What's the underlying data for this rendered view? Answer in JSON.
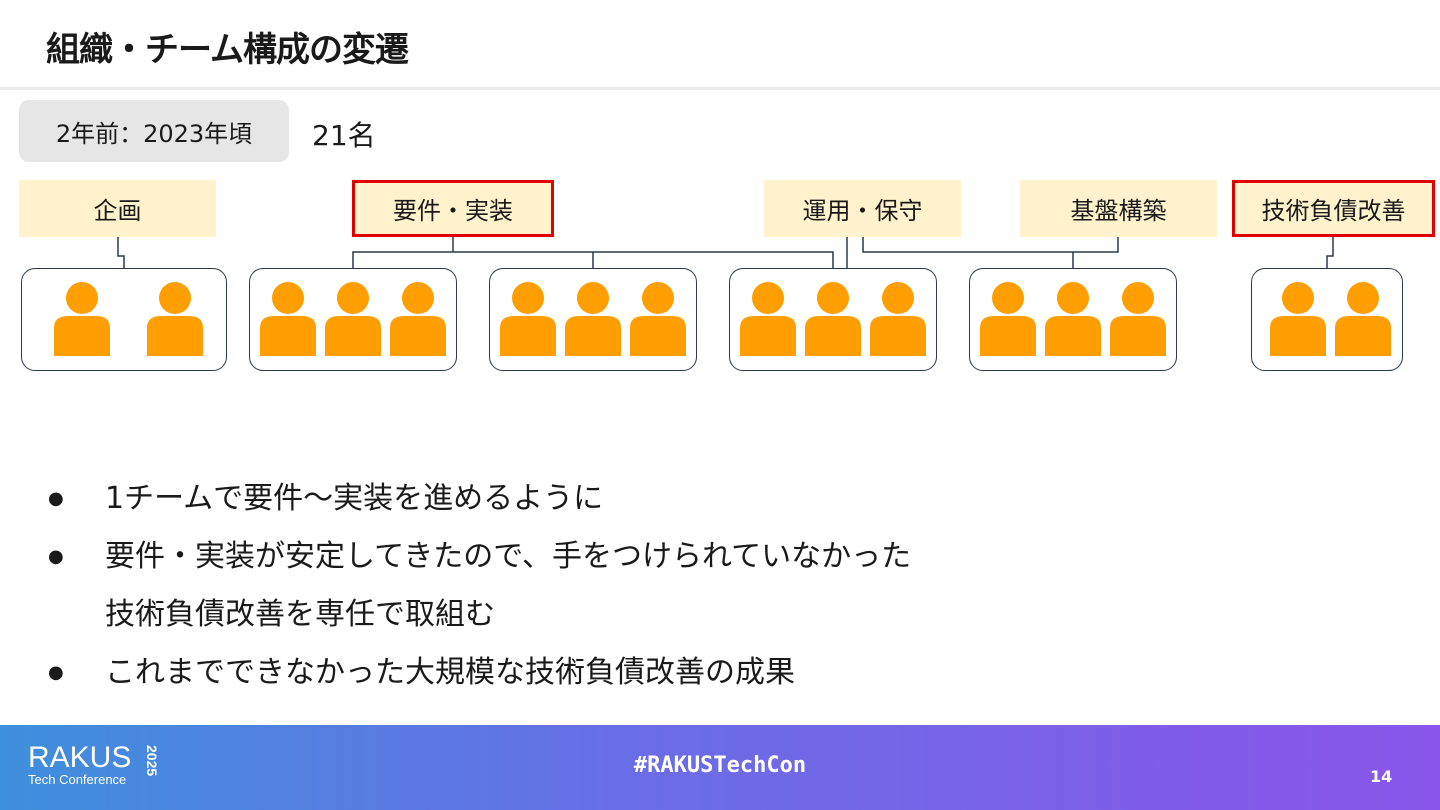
{
  "slide": {
    "title": "組織・チーム構成の変遷",
    "period": "2年前：2023年頃",
    "headcount": "21名"
  },
  "roles": [
    {
      "label": "企画",
      "highlighted": false
    },
    {
      "label": "要件・実装",
      "highlighted": true
    },
    {
      "label": "運用・保守",
      "highlighted": false
    },
    {
      "label": "基盤構築",
      "highlighted": false
    },
    {
      "label": "技術負債改善",
      "highlighted": true
    }
  ],
  "teams": [
    {
      "members": 2
    },
    {
      "members": 3
    },
    {
      "members": 3
    },
    {
      "members": 3
    },
    {
      "members": 3
    },
    {
      "members": 2
    }
  ],
  "bullets": [
    {
      "lines": [
        "1チームで要件～実装を進めるように"
      ]
    },
    {
      "lines": [
        "要件・実装が安定してきたので、手をつけられていなかった",
        "技術負債改善を専任で取組む"
      ]
    },
    {
      "lines": [
        "これまでできなかった大規模な技術負債改善の成果"
      ]
    }
  ],
  "bullet_glyph": "●",
  "footer": {
    "logo_name": "RAKUS",
    "logo_subtitle": "Tech Conference",
    "logo_year": "2025",
    "hashtag": "#RAKUSTechCon",
    "page_number": "14"
  },
  "colors": {
    "person": "#ff9e00",
    "label_bg": "#fff2cc",
    "highlight_border": "#e00000",
    "footer_gradient_start": "#3e8fdc",
    "footer_gradient_end": "#8a55ea"
  },
  "icons": {
    "member": "person-icon"
  }
}
